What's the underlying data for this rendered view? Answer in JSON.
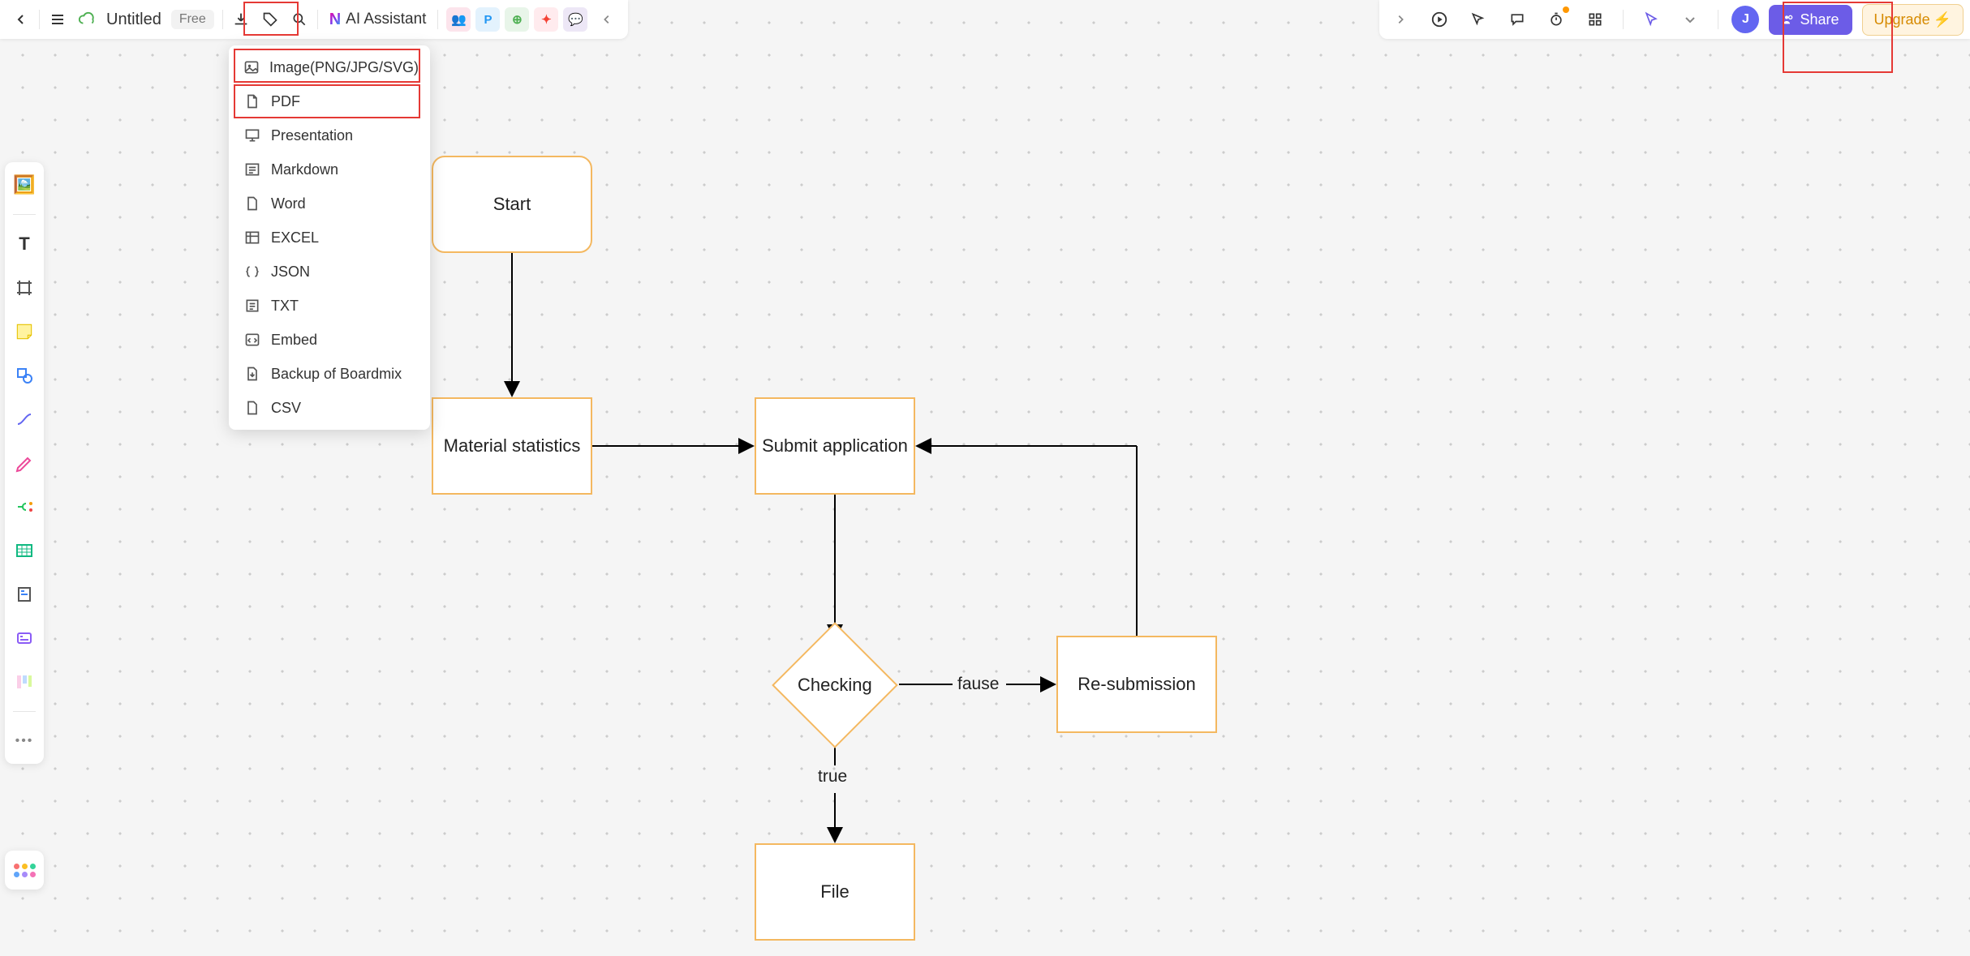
{
  "header": {
    "title": "Untitled",
    "badge": "Free",
    "ai_label": "AI Assistant",
    "share_label": "Share",
    "upgrade_label": "Upgrade",
    "avatar_initial": "J",
    "chips": [
      "",
      "P",
      "",
      "",
      ""
    ]
  },
  "export_menu": {
    "items": [
      "Image(PNG/JPG/SVG)",
      "PDF",
      "Presentation",
      "Markdown",
      "Word",
      "EXCEL",
      "JSON",
      "TXT",
      "Embed",
      "Backup of Boardmix",
      "CSV"
    ]
  },
  "flow": {
    "start": "Start",
    "material": "Material statistics",
    "submit": "Submit application",
    "checking": "Checking",
    "resub": "Re-submission",
    "file": "File",
    "edge_true": "true",
    "edge_fause": "fause"
  }
}
